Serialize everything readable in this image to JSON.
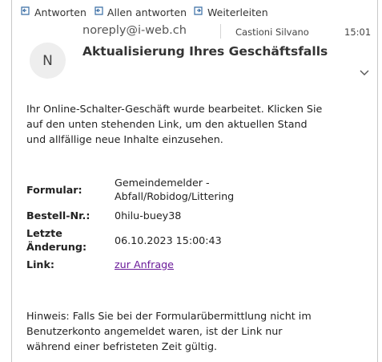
{
  "toolbar": {
    "reply_label": "Antworten",
    "reply_all_label": "Allen antworten",
    "forward_label": "Weiterleiten"
  },
  "header": {
    "avatar_initial": "N",
    "sender": "noreply@i-web.ch",
    "recipient": "Castioni Silvano",
    "time": "15:01",
    "subject": "Aktualisierung Ihres Geschäftsfalls"
  },
  "body": {
    "intro_lines": [
      "Ihr Online-Schalter-Geschäft wurde bearbeitet. Klicken Sie",
      "auf den unten stehenden Link, um den aktuellen Stand",
      "und allfällige neue Inhalte einzusehen."
    ],
    "fields": {
      "form_label": "Formular:",
      "form_value_lines": [
        "Gemeindemelder -",
        "Abfall/Robidog/Littering"
      ],
      "order_label": "Bestell-Nr.:",
      "order_value": "0hilu-buey38",
      "changed_label_lines": [
        "Letzte",
        "Änderung:"
      ],
      "changed_value": "06.10.2023 15:00:43",
      "link_label": "Link:",
      "link_text": "zur Anfrage"
    },
    "note_lines": [
      "Hinweis: Falls Sie bei der Formularübermittlung nicht im",
      "Benutzerkonto angemeldet waren, ist der Link nur",
      "während einer befristeten Zeit gültig."
    ]
  },
  "colors": {
    "link": "#6b1b9a",
    "icon": "#3a6ea5",
    "avatar_bg": "#eeeeee"
  }
}
